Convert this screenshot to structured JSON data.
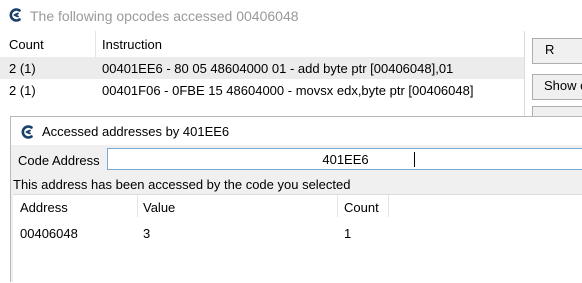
{
  "outer": {
    "title": "The following opcodes accessed 00406048",
    "columns": [
      "Count",
      "Instruction"
    ],
    "rows": [
      {
        "count": "2 (1)",
        "instruction": "00401EE6 - 80 05 48604000 01 - add byte ptr [00406048],01"
      },
      {
        "count": "2 (1)",
        "instruction": "00401F06 - 0FBE 15 48604000  - movsx edx,byte ptr [00406048]"
      }
    ],
    "right_buttons": [
      "R",
      "Show c"
    ]
  },
  "dialog": {
    "title": "Accessed addresses by 401EE6",
    "code_address_label": "Code Address",
    "code_address_value": "401EE6",
    "info_text": "This address has been accessed by the code you selected",
    "columns": [
      "Address",
      "Value",
      "Count"
    ],
    "rows": [
      {
        "address": "00406048",
        "value": "3",
        "count": "1"
      }
    ]
  },
  "colors": {
    "logo": "#1a3f6b",
    "selected_row": "#ececec",
    "dialog_bg": "#f0f0f0",
    "input_border": "#7aa9d6"
  },
  "icons": {
    "app_logo": "cheat-engine-logo-icon"
  }
}
